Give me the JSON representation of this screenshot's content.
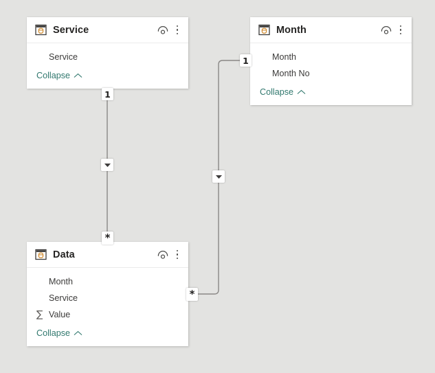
{
  "app": {
    "view_name": "model-view",
    "canvas_background": "#e3e3e1",
    "card_background": "#ffffff",
    "link_color": "#8a8886",
    "collapse_link_color": "#31786e",
    "title_color": "#252423"
  },
  "tables": [
    {
      "id": "service",
      "title": "Service",
      "icon": "table-icon",
      "hide_icon": "eye-hide-icon",
      "menu_icon": "more-options-icon",
      "collapse_label": "Collapse",
      "collapse_chevron": "chevron-up-icon",
      "fields": [
        {
          "name": "Service",
          "aggregation": ""
        }
      ]
    },
    {
      "id": "month",
      "title": "Month",
      "icon": "table-icon",
      "hide_icon": "eye-hide-icon",
      "menu_icon": "more-options-icon",
      "collapse_label": "Collapse",
      "collapse_chevron": "chevron-up-icon",
      "fields": [
        {
          "name": "Month",
          "aggregation": ""
        },
        {
          "name": "Month No",
          "aggregation": ""
        }
      ]
    },
    {
      "id": "data",
      "title": "Data",
      "icon": "table-icon",
      "hide_icon": "eye-hide-icon",
      "menu_icon": "more-options-icon",
      "collapse_label": "Collapse",
      "collapse_chevron": "chevron-up-icon",
      "fields": [
        {
          "name": "Month",
          "aggregation": ""
        },
        {
          "name": "Service",
          "aggregation": ""
        },
        {
          "name": "Value",
          "aggregation": "∑"
        }
      ]
    }
  ],
  "relationships": [
    {
      "id": "service-data",
      "from_table": "Service",
      "to_table": "Data",
      "from_cardinality": "1",
      "to_cardinality": "*",
      "cross_filter_direction": "single-down",
      "direction_icon": "arrow-down-icon"
    },
    {
      "id": "month-data",
      "from_table": "Month",
      "to_table": "Data",
      "from_cardinality": "1",
      "to_cardinality": "*",
      "cross_filter_direction": "single-down",
      "direction_icon": "arrow-down-icon"
    }
  ]
}
